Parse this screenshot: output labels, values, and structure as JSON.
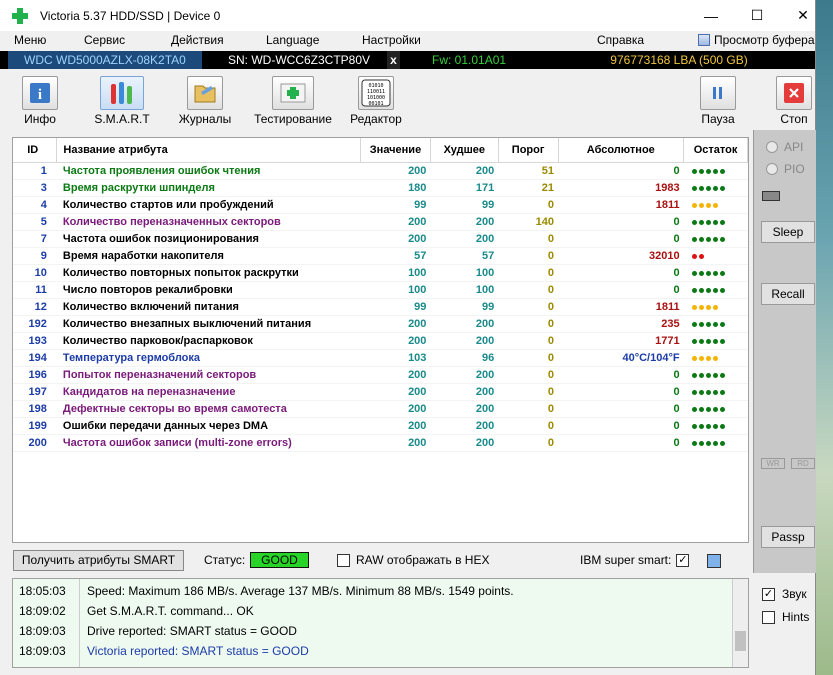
{
  "window": {
    "title": "Victoria 5.37 HDD/SSD | Device 0",
    "minimize": "—",
    "maximize": "☐",
    "close": "✕"
  },
  "menu": {
    "items": [
      "Меню",
      "Сервис",
      "Действия",
      "Language",
      "Настройки",
      "Справка"
    ],
    "buffer_view": "Просмотр буфера"
  },
  "drive": {
    "model": "WDC WD5000AZLX-08K2TA0",
    "serial": "SN: WD-WCC6Z3CTP80V",
    "x_button": "x",
    "firmware": "Fw: 01.01A01",
    "lba": "976773168 LBA (500 GB)"
  },
  "toolbar": {
    "info": "Инфо",
    "smart": "S.M.A.R.T",
    "logs": "Журналы",
    "testing": "Тестирование",
    "editor": "Редактор",
    "editor_icon_text": "01010\n110011\n101000\n00101",
    "pause": "Пауза",
    "stop": "Стоп"
  },
  "table": {
    "headers": {
      "id": "ID",
      "name": "Название атрибута",
      "value": "Значение",
      "worst": "Худшее",
      "threshold": "Порог",
      "raw": "Абсолютное",
      "remaining": "Остаток"
    },
    "rows": [
      {
        "id": "1",
        "name": "Частота проявления ошибок чтения",
        "value": "200",
        "worst": "200",
        "thr": "51",
        "raw": "0",
        "dots": "ggggg",
        "name_color": "#0c7a14"
      },
      {
        "id": "3",
        "name": "Время раскрутки шпинделя",
        "value": "180",
        "worst": "171",
        "thr": "21",
        "raw": "1983",
        "dots": "ggggg",
        "name_color": "#0c7a14"
      },
      {
        "id": "4",
        "name": "Количество стартов или пробуждений",
        "value": "99",
        "worst": "99",
        "thr": "0",
        "raw": "1811",
        "dots": "yyyy",
        "name_color": "#000000"
      },
      {
        "id": "5",
        "name": "Количество переназначенных секторов",
        "value": "200",
        "worst": "200",
        "thr": "140",
        "raw": "0",
        "dots": "ggggg",
        "name_color": "#7a1a7a"
      },
      {
        "id": "7",
        "name": "Частота ошибок позиционирования",
        "value": "200",
        "worst": "200",
        "thr": "0",
        "raw": "0",
        "dots": "ggggg",
        "name_color": "#000000"
      },
      {
        "id": "9",
        "name": "Время наработки накопителя",
        "value": "57",
        "worst": "57",
        "thr": "0",
        "raw": "32010",
        "dots": "rr",
        "name_color": "#000000"
      },
      {
        "id": "10",
        "name": "Количество повторных попыток раскрутки",
        "value": "100",
        "worst": "100",
        "thr": "0",
        "raw": "0",
        "dots": "ggggg",
        "name_color": "#000000"
      },
      {
        "id": "11",
        "name": "Число повторов рекалибровки",
        "value": "100",
        "worst": "100",
        "thr": "0",
        "raw": "0",
        "dots": "ggggg",
        "name_color": "#000000"
      },
      {
        "id": "12",
        "name": "Количество включений питания",
        "value": "99",
        "worst": "99",
        "thr": "0",
        "raw": "1811",
        "dots": "yyyy",
        "name_color": "#000000"
      },
      {
        "id": "192",
        "name": "Количество внезапных выключений питания",
        "value": "200",
        "worst": "200",
        "thr": "0",
        "raw": "235",
        "dots": "ggggg",
        "name_color": "#000000"
      },
      {
        "id": "193",
        "name": "Количество парковок/распарковок",
        "value": "200",
        "worst": "200",
        "thr": "0",
        "raw": "1771",
        "dots": "ggggg",
        "name_color": "#000000"
      },
      {
        "id": "194",
        "name": "Температура гермоблока",
        "value": "103",
        "worst": "96",
        "thr": "0",
        "raw": "40°C/104°F",
        "dots": "yyyy",
        "name_color": "#1c3ca8",
        "raw_color": "#1c3ca8"
      },
      {
        "id": "196",
        "name": "Попыток переназначений секторов",
        "value": "200",
        "worst": "200",
        "thr": "0",
        "raw": "0",
        "dots": "ggggg",
        "name_color": "#7a1a7a"
      },
      {
        "id": "197",
        "name": "Кандидатов на переназначение",
        "value": "200",
        "worst": "200",
        "thr": "0",
        "raw": "0",
        "dots": "ggggg",
        "name_color": "#7a1a7a"
      },
      {
        "id": "198",
        "name": "Дефектные секторы во время самотеста",
        "value": "200",
        "worst": "200",
        "thr": "0",
        "raw": "0",
        "dots": "ggggg",
        "name_color": "#7a1a7a"
      },
      {
        "id": "199",
        "name": "Ошибки передачи данных через DMA",
        "value": "200",
        "worst": "200",
        "thr": "0",
        "raw": "0",
        "dots": "ggggg",
        "name_color": "#000000"
      },
      {
        "id": "200",
        "name": "Частота ошибок записи (multi-zone errors)",
        "value": "200",
        "worst": "200",
        "thr": "0",
        "raw": "0",
        "dots": "ggggg",
        "name_color": "#7a1a7a"
      }
    ]
  },
  "right_panel": {
    "api": "API",
    "pio": "PIO",
    "sleep": "Sleep",
    "recall": "Recall",
    "wr": "WR",
    "rd": "RD",
    "passp": "Passp"
  },
  "status": {
    "get_attrs": "Получить атрибуты SMART",
    "label": "Статус:",
    "value": "GOOD",
    "raw_hex": "RAW отображать в HEX",
    "ibm": "IBM super smart:",
    "ibm_check": "✓"
  },
  "log": [
    {
      "time": "18:05:03",
      "msg": "Speed: Maximum 186 MB/s. Average 137 MB/s. Minimum 88 MB/s. 1549 points.",
      "color": "#000000"
    },
    {
      "time": "18:09:02",
      "msg": "Get S.M.A.R.T. command... OK",
      "color": "#000000"
    },
    {
      "time": "18:09:03",
      "msg": "Drive reported: SMART status = GOOD",
      "color": "#000000"
    },
    {
      "time": "18:09:03",
      "msg": "Victoria reported: SMART status = GOOD",
      "color": "#1c3ca8"
    }
  ],
  "options": {
    "sound": "Звук",
    "sound_check": "✓",
    "hints": "Hints"
  }
}
